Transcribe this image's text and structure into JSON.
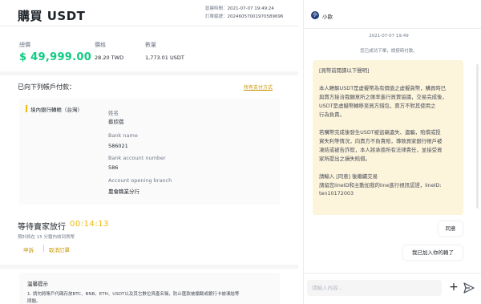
{
  "header": {
    "title": "購買 USDT",
    "created_label": "創建時間：",
    "created_value": "2021-07-07 19:49:24",
    "order_label": "訂單編號：",
    "order_value": "20246057001970589696"
  },
  "summary": {
    "total_label": "總價",
    "total_value": "$ 49,999.00",
    "price_label": "價格",
    "price_value": "28.20 TWD",
    "qty_label": "數量",
    "qty_value": "1,773.01 USDT"
  },
  "payment": {
    "heading": "已向下列帳戶付款：",
    "all_methods_link": "所有支付方式",
    "method_name": "境內銀行轉帳（台灣）",
    "fields": [
      {
        "label": "姓名",
        "value": "蔡欣蓓"
      },
      {
        "label": "Bank name",
        "value": "586021"
      },
      {
        "label": "Bank account number",
        "value": "586"
      },
      {
        "label": "Account opening branch",
        "value": "農會職業分行"
      }
    ]
  },
  "waiting": {
    "label": "等待賣家放行",
    "timer": "00:14:13",
    "note": "預計將在 15 分鐘內收到貨幣",
    "appeal_label": "申訴",
    "cancel_label": "取消訂單"
  },
  "tips": {
    "title": "溫馨提示",
    "line1": "1. 請勿將賬戶代碼存放BTC、BNB、ETH、USDT以及其它數位資產名稱，防止匯款被攔截或銀行卡被凍結等",
    "line2": "問題。"
  },
  "chat": {
    "nickname": "小歐",
    "avatar_letter": "小",
    "timestamp": "2021-07-07 19:49",
    "system_msg": "您已成功下單，請按時付款。",
    "seller_lines": [
      "[買幣前閱讀以下聲明]",
      "",
      "本人瞭解USDT是虛擬幣為有價值之虛擬貨幣，購買時已",
      "與賣方接洽我願意所之匯率進行買賣協議，交易完成後，",
      "USDT是虛擬幣轉移至買方錢包，賣方不對其使用之",
      "行為負責。",
      "",
      "若購幣完成後發生USDT被盜竊遺失、遺騙，賠償或投",
      "資失利等情況，向賣方不負責賠，導致買家銀行帳戶被",
      "凍結或被告詐欺，本人將承擔所有法律責任，並接受買",
      "家所提出之損失賠償。",
      "",
      "請輸入 [同意] 後繼續交易",
      "請留您lineID和主動加我的line進行視訊認證，lineID:",
      "ten10172003"
    ],
    "reply1": "同意",
    "reply2": "我已加入你的賴了",
    "input_placeholder": "請輸入內容..."
  },
  "colors": {
    "accent": "#f0b90b",
    "link": "#c99400",
    "positive": "#0ecb81",
    "bubble": "#fdf4dc"
  }
}
